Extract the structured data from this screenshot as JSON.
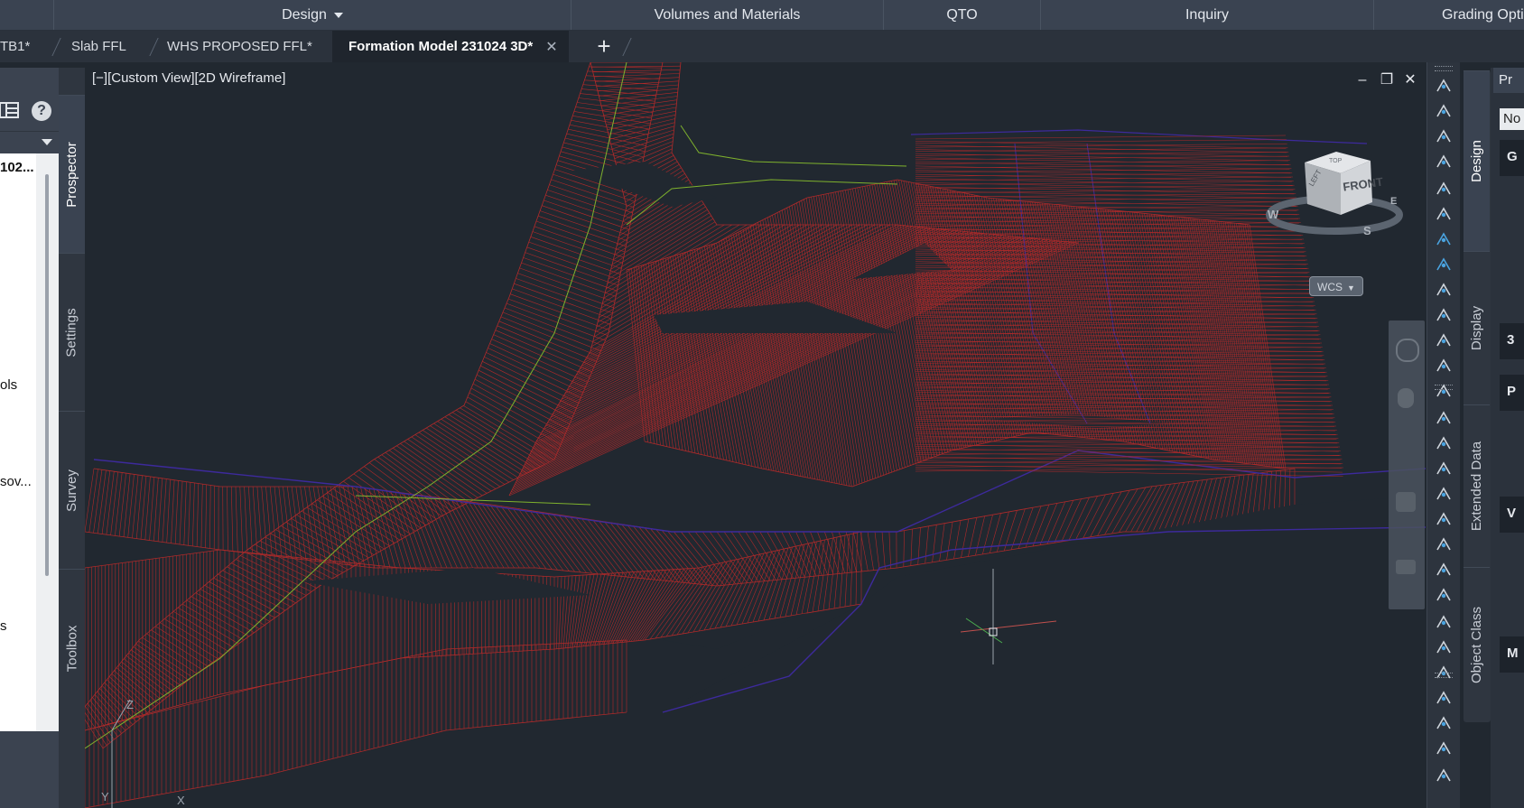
{
  "ribbon": {
    "panels": [
      {
        "label": "Design"
      },
      {
        "label": "Volumes and Materials"
      },
      {
        "label": "QTO"
      },
      {
        "label": "Inquiry"
      },
      {
        "label": "Grading Opti"
      }
    ]
  },
  "tabs": [
    {
      "label": "TB1*"
    },
    {
      "label": "Slab FFL"
    },
    {
      "label": "WHS PROPOSED FFL*"
    },
    {
      "label": "Formation Model 231024 3D*",
      "close": "✕"
    }
  ],
  "add_tab": "+",
  "toolspace": {
    "help": "?",
    "items": [
      "102...",
      "ols",
      "sov...",
      "s"
    ],
    "vertical_tabs": [
      "Prospector",
      "Settings",
      "Survey",
      "Toolbox"
    ]
  },
  "viewport": {
    "label": "[−][Custom View][2D Wireframe]",
    "viewcube": {
      "front": "FRONT",
      "left": "LEFT",
      "top": "TOP",
      "compass": [
        "W",
        "S",
        "E"
      ]
    },
    "wcs": "WCS",
    "ucs": {
      "z": "Z",
      "y": "Y",
      "x": "X"
    }
  },
  "colors": {
    "mesh": "#b02a2a",
    "boundary": "#3d2a9c",
    "feature_line": "#7fb22d",
    "background": "#212830"
  },
  "properties": {
    "vertical_tabs": [
      "Design",
      "Display",
      "Extended Data",
      "Object Class"
    ],
    "header": "Pr",
    "dropdown": "No",
    "section_labels": [
      "G",
      "3",
      "P",
      "V",
      "M"
    ]
  }
}
